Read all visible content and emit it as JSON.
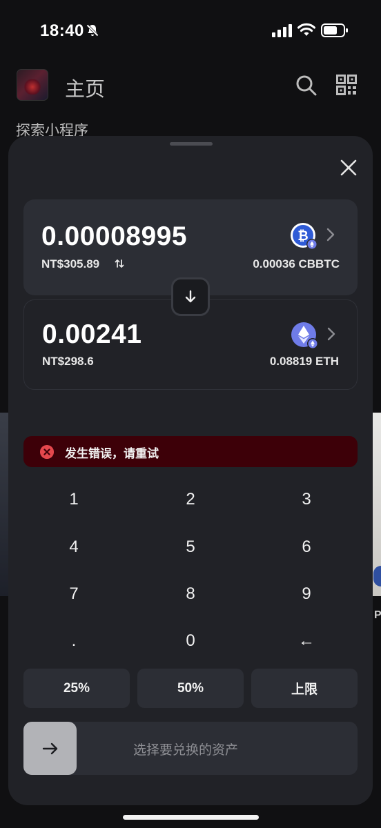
{
  "status_bar": {
    "time": "18:40"
  },
  "background": {
    "title": "主页",
    "subtitle": "探索小程序",
    "peek_text": "P"
  },
  "swap": {
    "from": {
      "amount": "0.00008995",
      "fiat": "NT$305.89",
      "balance": "0.00036 CBBTC",
      "token_icon": "bitcoin-icon"
    },
    "to": {
      "amount": "0.00241",
      "fiat": "NT$298.6",
      "balance": "0.08819 ETH",
      "token_icon": "ethereum-icon"
    },
    "error_message": "发生错误，请重试",
    "keypad": {
      "k1": "1",
      "k2": "2",
      "k3": "3",
      "k4": "4",
      "k5": "5",
      "k6": "6",
      "k7": "7",
      "k8": "8",
      "k9": "9",
      "kdot": ".",
      "k0": "0",
      "kback": "←"
    },
    "percent_buttons": {
      "p25": "25%",
      "p50": "50%",
      "max": "上限"
    },
    "slide_prompt": "选择要兑换的资产"
  },
  "colors": {
    "sheet_bg": "#212227",
    "card_bg": "#2c2e35",
    "error_bg": "#3d0008",
    "error_icon": "#e5484d",
    "btc_blue": "#2f5bd6",
    "eth_purple": "#6f7ce8"
  }
}
